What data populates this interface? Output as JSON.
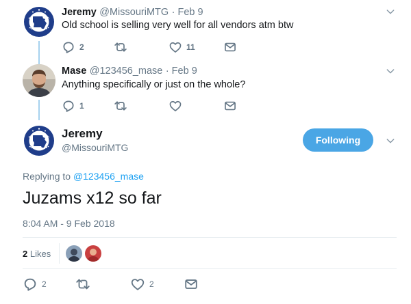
{
  "tweets": [
    {
      "name": "Jeremy",
      "handle": "@MissouriMTG",
      "date": "· Feb 9",
      "text": "Old school is selling very well for all vendors atm btw",
      "replies": "2",
      "likes": "11"
    },
    {
      "name": "Mase",
      "handle": "@123456_mase",
      "date": "· Feb 9",
      "text": "Anything specifically or just on the whole?",
      "replies": "1",
      "likes": ""
    }
  ],
  "main": {
    "name": "Jeremy",
    "handle": "@MissouriMTG",
    "follow_label": "Following",
    "replying_prefix": "Replying to",
    "replying_handle": "@123456_mase",
    "text": "Juzams x12 so far",
    "timestamp": "8:04 AM - 9 Feb 2018",
    "likes_count": "2",
    "likes_label": "Likes",
    "replies": "2",
    "like_count_action": "2"
  },
  "colors": {
    "accent": "#1da1f2",
    "follow_bg": "#4aa6e5",
    "muted": "#657786"
  },
  "icons": [
    "reply-icon",
    "retweet-icon",
    "heart-icon",
    "message-icon",
    "chevron-down-icon"
  ]
}
